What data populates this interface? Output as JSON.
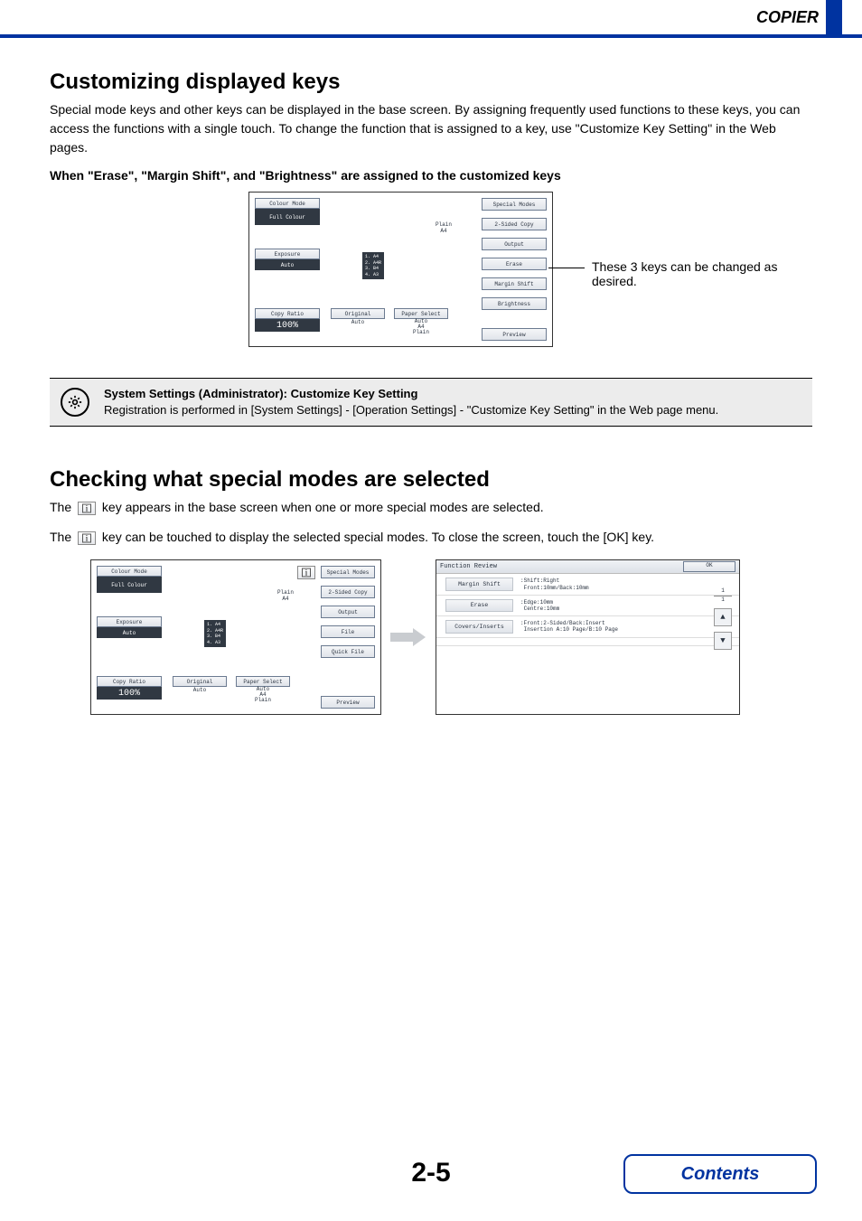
{
  "header": {
    "section": "COPIER"
  },
  "section1": {
    "title": "Customizing displayed keys",
    "intro": "Special mode keys and other keys can be displayed in the base screen. By assigning frequently used functions to these keys, you can access the functions with a single touch. To change the function that is assigned to a key, use \"Customize Key Setting\" in the Web pages.",
    "example_heading": "When \"Erase\", \"Margin Shift\", and \"Brightness\" are assigned to the customized keys",
    "panel": {
      "colour_mode": "Colour Mode",
      "full_colour": "Full Colour",
      "exposure": "Exposure",
      "auto": "Auto",
      "copy_ratio": "Copy Ratio",
      "ratio_value": "100%",
      "original": "Original",
      "paper_select": "Paper Select",
      "auto_paper_l1": "Auto",
      "auto_paper_l2": "A4",
      "auto_paper_l3": "Plain",
      "plain": "Plain",
      "a4": "A4",
      "trays": [
        "A4",
        "A4R",
        "B4",
        "A3"
      ],
      "right_buttons": [
        "Special Modes",
        "2-Sided Copy",
        "Output",
        "Erase",
        "Margin Shift",
        "Brightness",
        "Preview"
      ]
    },
    "panel_caption": "These 3 keys can be changed as desired.",
    "callout_title": "System Settings (Administrator): Customize Key Setting",
    "callout_body": "Registration is performed in [System Settings] - [Operation Settings] - \"Customize Key Setting\" in the Web page menu."
  },
  "section2": {
    "title": "Checking what special modes are selected",
    "line1_a": "The ",
    "line1_b": " key appears in the base screen when one or more special modes are selected.",
    "line2_a": "The ",
    "line2_b": " key can be touched to display the selected special modes. To close the screen, touch the [OK] key.",
    "panel": {
      "right_buttons": [
        "Special Modes",
        "2-Sided Copy",
        "Output",
        "File",
        "Quick File",
        "Preview"
      ]
    },
    "review": {
      "header": "Function Review",
      "ok": "OK",
      "rows": [
        {
          "label": "Margin Shift",
          "desc1": "Shift:Right",
          "desc2": "Front:10mm/Back:10mm"
        },
        {
          "label": "Erase",
          "desc1": "Edge:10mm",
          "desc2": "Centre:10mm"
        },
        {
          "label": "Covers/Inserts",
          "desc1": "Front:2-Sided/Back:Insert",
          "desc2": "Insertion A:10 Page/B:10 Page"
        }
      ],
      "page_cur": "1",
      "page_total": "1"
    }
  },
  "footer": {
    "page_number": "2-5",
    "contents": "Contents"
  }
}
